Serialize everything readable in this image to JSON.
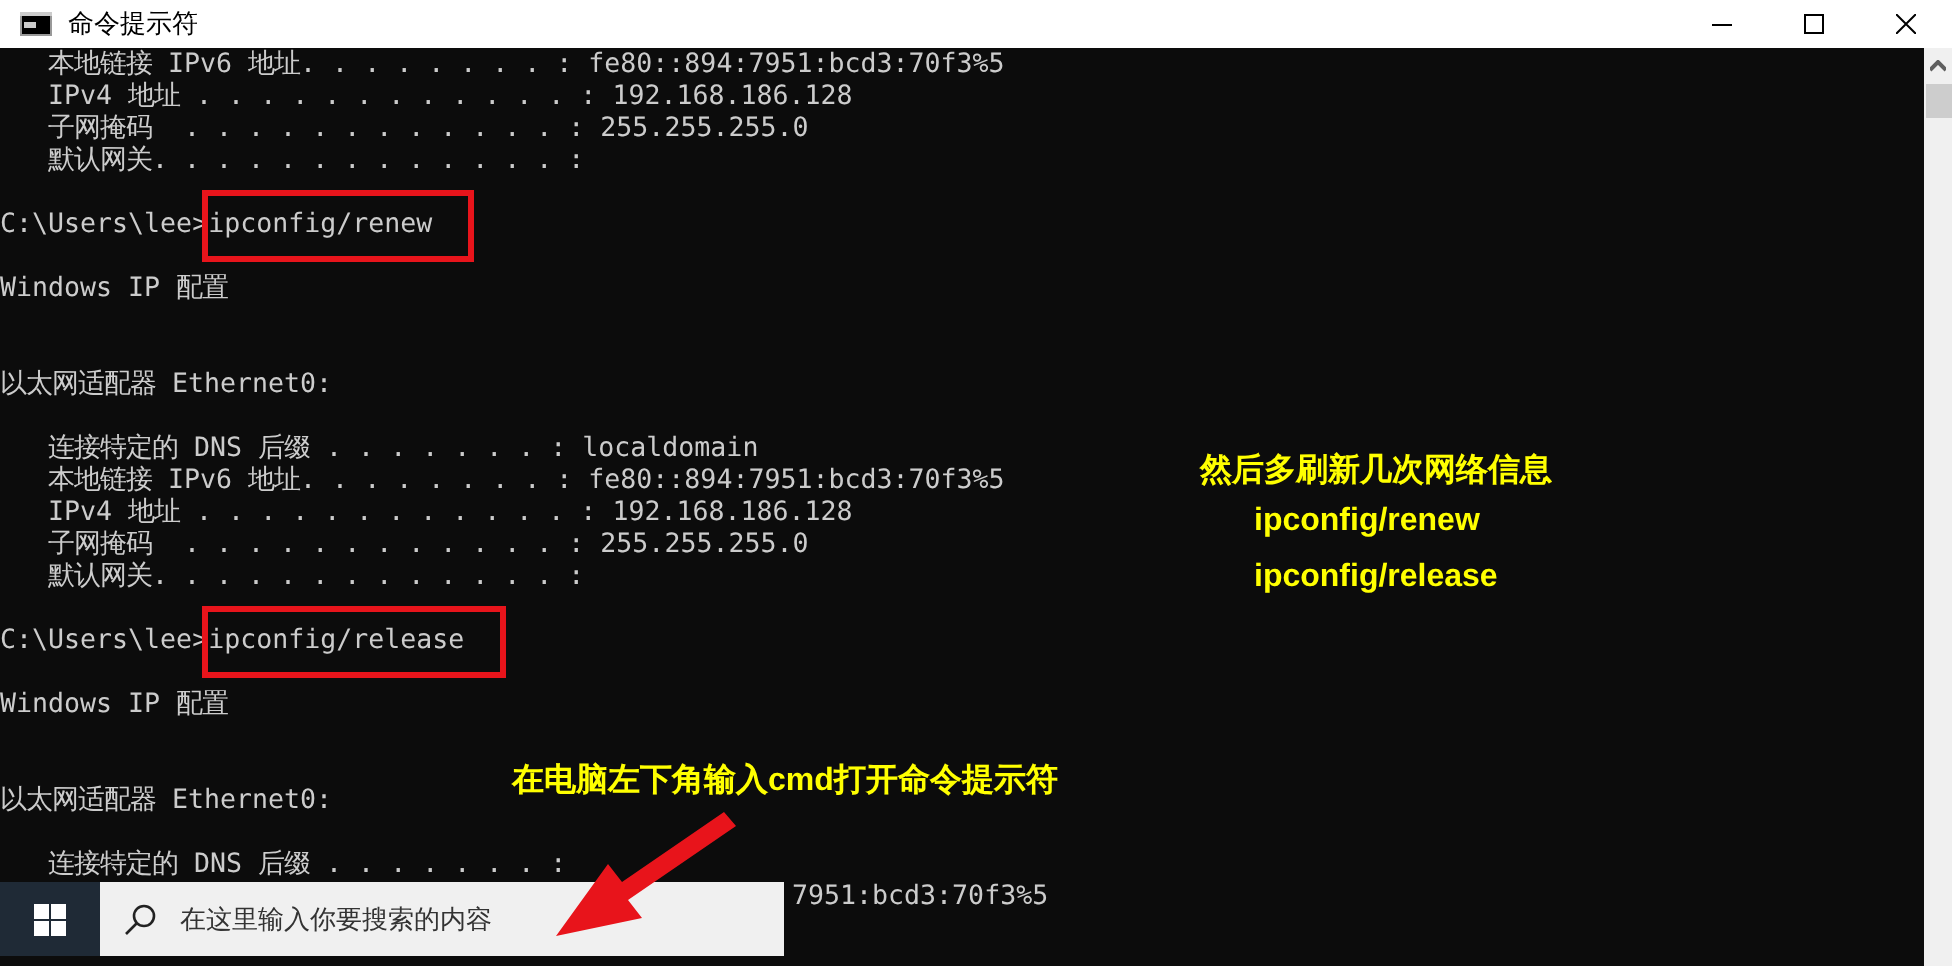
{
  "window": {
    "title": "命令提示符"
  },
  "console": {
    "lines": [
      {
        "kind": "text",
        "text": "   本地链接 IPv6 地址. . . . . . . . : fe80::894:7951:bcd3:70f3%5"
      },
      {
        "kind": "text",
        "text": "   IPv4 地址 . . . . . . . . . . . . : 192.168.186.128"
      },
      {
        "kind": "text",
        "text": "   子网掩码  . . . . . . . . . . . . : 255.255.255.0"
      },
      {
        "kind": "text",
        "text": "   默认网关. . . . . . . . . . . . . :"
      },
      {
        "kind": "blank"
      },
      {
        "kind": "command",
        "prompt": "C:\\Users\\lee>",
        "command": "ipconfig/renew",
        "highlighted": true
      },
      {
        "kind": "blank"
      },
      {
        "kind": "text",
        "text": "Windows IP 配置"
      },
      {
        "kind": "blank"
      },
      {
        "kind": "blank"
      },
      {
        "kind": "text",
        "text": "以太网适配器 Ethernet0:"
      },
      {
        "kind": "blank"
      },
      {
        "kind": "text",
        "text": "   连接特定的 DNS 后缀 . . . . . . . : localdomain"
      },
      {
        "kind": "text",
        "text": "   本地链接 IPv6 地址. . . . . . . . : fe80::894:7951:bcd3:70f3%5"
      },
      {
        "kind": "text",
        "text": "   IPv4 地址 . . . . . . . . . . . . : 192.168.186.128"
      },
      {
        "kind": "text",
        "text": "   子网掩码  . . . . . . . . . . . . : 255.255.255.0"
      },
      {
        "kind": "text",
        "text": "   默认网关. . . . . . . . . . . . . :"
      },
      {
        "kind": "blank"
      },
      {
        "kind": "command",
        "prompt": "C:\\Users\\lee>",
        "command": "ipconfig/release",
        "highlighted": true
      },
      {
        "kind": "blank"
      },
      {
        "kind": "text",
        "text": "Windows IP 配置"
      },
      {
        "kind": "blank"
      },
      {
        "kind": "blank"
      },
      {
        "kind": "text",
        "text": "以太网适配器 Ethernet0:"
      },
      {
        "kind": "blank"
      },
      {
        "kind": "text",
        "text": "   连接特定的 DNS 后缀 . . . . . . . :"
      },
      {
        "kind": "fragment",
        "text": "7951:bcd3:70f3%5"
      }
    ]
  },
  "annotations": [
    {
      "kind": "note",
      "lines": [
        "然后多刷新几次网络信息",
        "ipconfig/renew",
        "ipconfig/release"
      ]
    },
    {
      "kind": "callout",
      "lines": [
        "在电脑左下角输入cmd打开命令提示符"
      ]
    }
  ],
  "taskbar": {
    "search": {
      "placeholder": "在这里输入你要搜索的内容"
    }
  }
}
